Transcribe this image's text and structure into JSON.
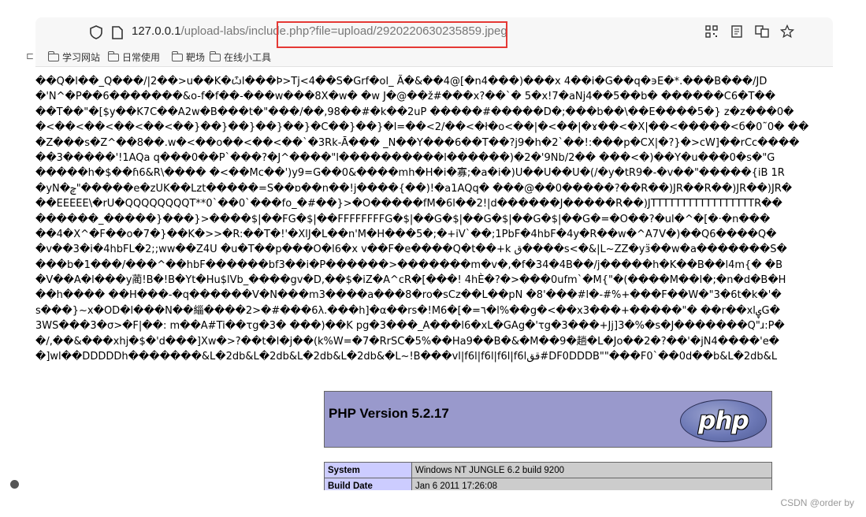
{
  "browser": {
    "url_host": "127.0.0.1",
    "url_path": "/upload-labs/include.php?file=upload/2920220630235859.jpeg",
    "bookmarks": [
      "学习网站",
      "日常使用",
      "靶场",
      "在线小工具"
    ],
    "bookmark_prefix": "⊏"
  },
  "garbage_lines": [
    "��Q�l��_Q���/|2��>u��K�ѽl���Þ>Tj<4��S�Grf�ol_ Ã�&��4@[�n4���)���x 4��i�G��q�϶E�*.���B���/JD",
    "�'N^�P��6�������&o-f�f��-���w���8X�w� �w J�@��ž#���x?��`� 5�x!7�aNj4��5��b� ������C6�T��",
    "��T��\"�[$y��K7C��A2w�B���t�\"���/��,98��#�k��2uP �����#�����D�;���b��\\��E����5�} z�z���0�",
    "�<��<��<��<��<��}��}��}��}��}�C��}��}�l=��<2/��<�ł�o<��|�<��|�ɤ��<�X|��<�����<б�0˜0� ��",
    "�Z���s�Z^��8��.w�<��o��<��<��`�3Rk-Ā��� _N��Y���6��T��?j9�h�2`��!:���p�CX|�?}�>cW]��rCc����",
    "��3�����'!1AQa q���0��P`���?�J^����\"l����������l������)�2�'9Nb/2�� ���<�)��Y�u���0�s�\"G",
    "�����h�$��ɦ6&R\\���� �<��Mc��')y9=G��0&����mh�H�i�寡;�a�i�)U��U��U�(/�y�tR9�-�v��\"�����{iB 1R",
    "�yN�ݼ\"�����e�zUK��Lzt�����=S��ɒ��n��!j����{��)!�a1AQq� ���@��0�����?��R��)JR��R��)JR��)JR�",
    "��EEEEE\\�rU�QQQQQQQQT**0`��0`���fo_�#��}>�O�����fM�6l��2!|d������J�����R��)JTTTTTTTTTTTTTTTTTR��",
    "������_�����}���}>����$|��FG�$|��FFFFFFFFG�$|��G�$|��G�$|��G�$|��G�=�O��?�ul�^�[�·�n���",
    "��4�X^�F��o�7�}��K�>>�R:��T�!'�XlJ�L��n'M�H���5�;�+iV`��;1PbF�4hbF�4y�R��w�^A7V�)��Q6����Q�",
    "�v��3�i�4hbFL�2;;ww��Z4U �u�T��p���O�l6�x v��F�e����Q�t��+k ق����s<�&|L~ZZ�yӟ��w�a�������S�",
    "���b�1���/���^��hbF������bf3��i�P������>�������m�v�,�f�34�4B��/j�����h�K��B��l4m{� �B",
    "�V��A�l���y蔺!B�!B�Yt�Hu$lVb_����gv�D,��$�iZ�A^cR�[���! 4hÈ�?�>���0ufm`�M{\"�(����M��l�;�n�d�B�H",
    "��h���� ��H���-�q������V�N���m3����a���8�ro�sCz��L��pN �8'���#l�-#%+���F��W�\"3�6t�k�'�",
    "s���}~x�OD�l���N��緇����2>�#���6λ.���h]�α��rs�!M6�[�=٦�l%��g�<��x3���+�����\"� ��r��xlۑG�",
    "3WS���3�σ>�F|��: m��A#Ti��τg�3� ���)��K pg�3���_A���l6�xL�GAg�'τg�3���+Jj]3�%�s�J�������Q\"ɹ:P�",
    "�/,��&���xhj�$�'d���]Xw�>?��t�l�j��(k%W=�7�RrSC�5%��Ha9��B�&�M��9�趟�L�Jo��2�?��'�jN4����'e�",
    "�]wl��DDDDDh�������&L�2db&L�2db&L�2db&L�2db&�L~!B���vl|f6l|f6l|f6l|f6lقق#DF0DDDB\"\"���F0`��0d��b&L�2db&L"
  ],
  "phpinfo": {
    "title": "PHP Version 5.2.17",
    "logo_text": "php",
    "rows": [
      {
        "key": "System",
        "value": "Windows NT JUNGLE 6.2 build 9200"
      },
      {
        "key": "Build Date",
        "value": "Jan 6 2011 17:26:08"
      }
    ],
    "colors": {
      "header_bg": "#9999cc",
      "key_bg": "#ccccff",
      "value_bg": "#cccccc"
    }
  },
  "watermark": "CSDN @order by"
}
